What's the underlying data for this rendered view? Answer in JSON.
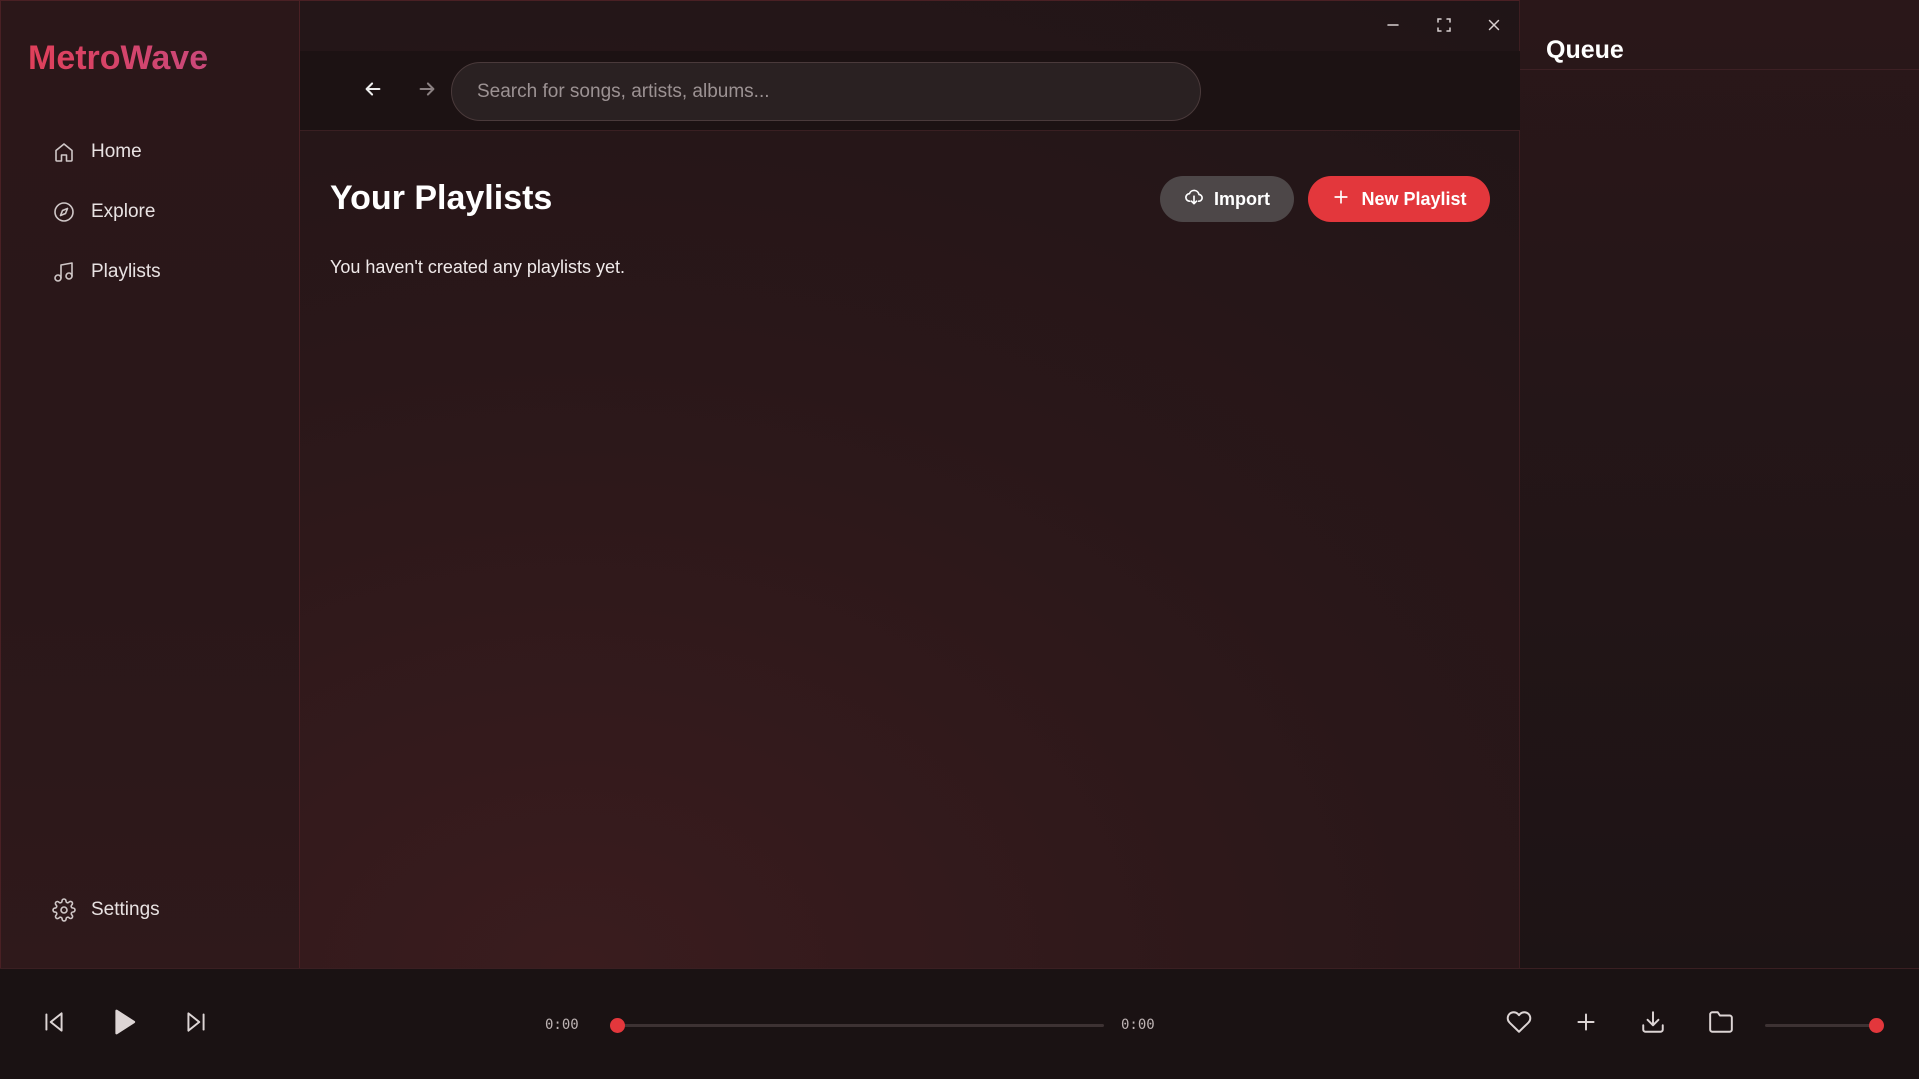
{
  "app": {
    "name": "MetroWave"
  },
  "colors": {
    "accent": "#e3373c",
    "import_button": "#4d4748",
    "background": "#2a1719"
  },
  "sidebar": {
    "items": [
      {
        "label": "Home",
        "icon": "home-icon"
      },
      {
        "label": "Explore",
        "icon": "compass-icon"
      },
      {
        "label": "Playlists",
        "icon": "music-note-icon"
      }
    ],
    "settings": {
      "label": "Settings",
      "icon": "gear-icon"
    }
  },
  "toolbar": {
    "back_icon": "arrow-left-icon",
    "forward_icon": "arrow-right-icon",
    "search": {
      "placeholder": "Search for songs, artists, albums...",
      "value": ""
    }
  },
  "window_controls": {
    "minimize_icon": "minimize-icon",
    "maximize_icon": "maximize-icon",
    "close_icon": "close-icon"
  },
  "main": {
    "title": "Your Playlists",
    "empty_message": "You haven't created any playlists yet.",
    "import_label": "Import",
    "new_playlist_label": "New Playlist"
  },
  "queue": {
    "title": "Queue"
  },
  "player": {
    "elapsed": "0:00",
    "duration": "0:00",
    "progress": 0,
    "volume": 1.0
  }
}
